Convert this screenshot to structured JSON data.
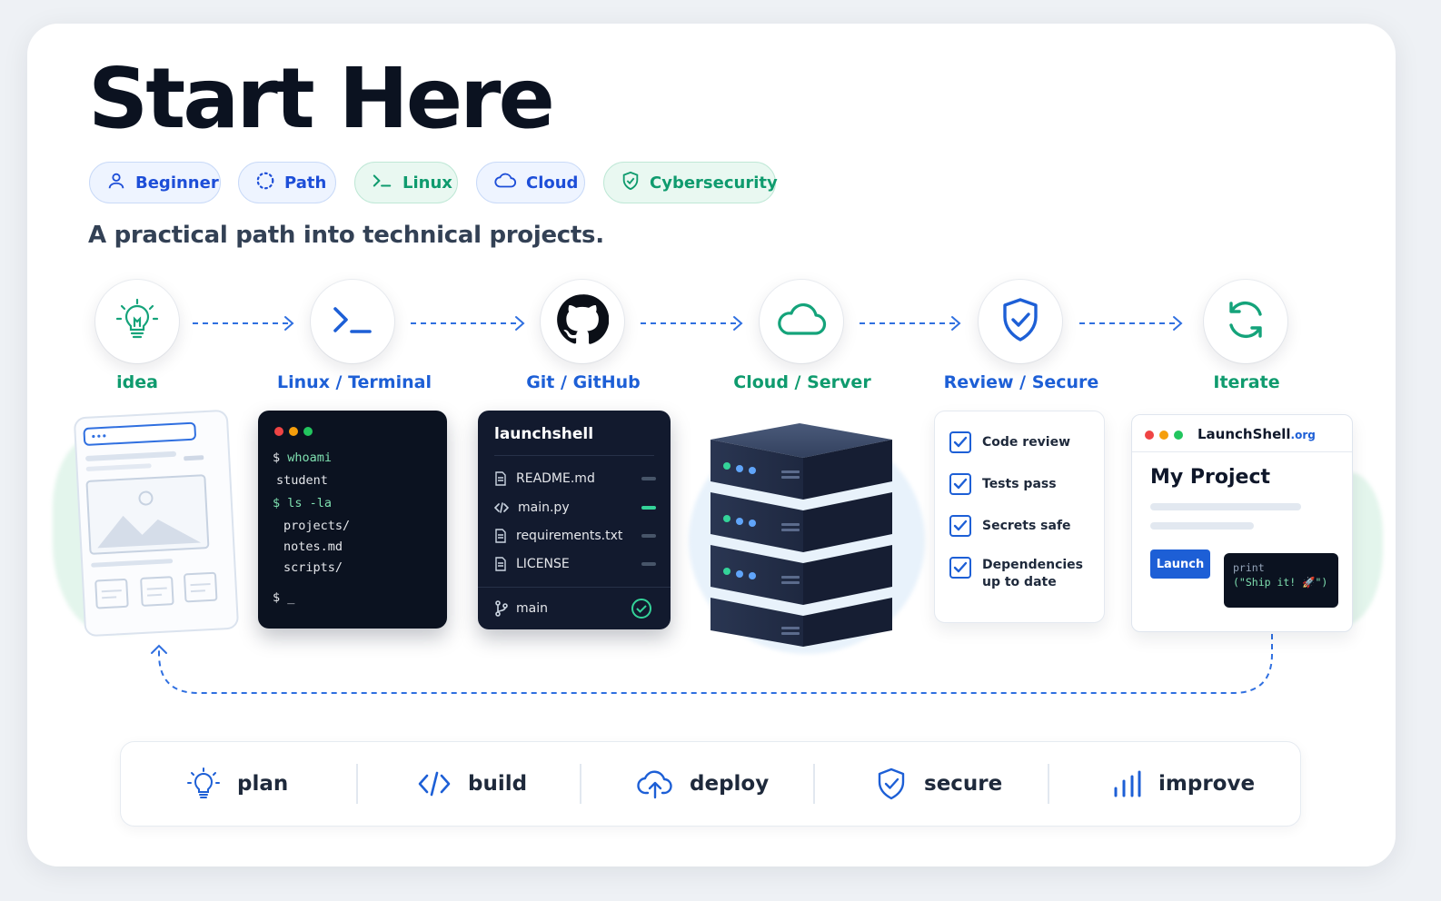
{
  "header": {
    "title": "Start Here",
    "subtitle": "A practical path into technical projects.",
    "tags": [
      {
        "label": "Beginner",
        "icon": "user-icon",
        "tone": "blue"
      },
      {
        "label": "Path",
        "icon": "dotted-circle-icon",
        "tone": "blue"
      },
      {
        "label": "Linux",
        "icon": "terminal-prompt-icon",
        "tone": "green"
      },
      {
        "label": "Cloud",
        "icon": "cloud-icon",
        "tone": "blue"
      },
      {
        "label": "Cybersecurity",
        "icon": "shield-check-icon",
        "tone": "green"
      }
    ]
  },
  "steps": [
    {
      "label": "idea",
      "icon": "lightbulb-icon"
    },
    {
      "label": "Linux / Terminal",
      "icon": "terminal-icon"
    },
    {
      "label": "Git / GitHub",
      "icon": "github-icon"
    },
    {
      "label": "Cloud / Server",
      "icon": "cloud-icon"
    },
    {
      "label": "Review / Secure",
      "icon": "shield-check-icon"
    },
    {
      "label": "Iterate",
      "icon": "refresh-icon"
    }
  ],
  "terminal": {
    "lines": [
      {
        "prompt": "$ ",
        "text": "whoami"
      },
      {
        "prompt": "",
        "text": "student"
      },
      {
        "prompt": "$ ",
        "text": "ls -la"
      },
      {
        "prompt": "",
        "text": "projects/"
      },
      {
        "prompt": "",
        "text": "notes.md"
      },
      {
        "prompt": "",
        "text": "scripts/"
      },
      {
        "prompt": "$ ",
        "text": "_"
      }
    ]
  },
  "repo": {
    "name": "launchshell",
    "files": [
      "README.md",
      "main.py",
      "requirements.txt",
      "LICENSE"
    ],
    "branch": "main"
  },
  "checklist": {
    "items": [
      "Code review",
      "Tests pass",
      "Secrets safe",
      "Dependencies up to date"
    ],
    "checked": [
      true,
      true,
      true,
      true
    ]
  },
  "browser": {
    "site_name": "LaunchShell",
    "site_tld": ".org",
    "page_title": "My Project",
    "button_label": "Launch",
    "code_line1": "print",
    "code_line2": "(\"Ship it! 🚀\")"
  },
  "bottom_bar": [
    {
      "label": "plan",
      "icon": "lightbulb-icon"
    },
    {
      "label": "build",
      "icon": "code-icon"
    },
    {
      "label": "deploy",
      "icon": "cloud-upload-icon"
    },
    {
      "label": "secure",
      "icon": "shield-check-icon"
    },
    {
      "label": "improve",
      "icon": "bar-chart-icon"
    }
  ],
  "colors": {
    "blue": "#1d5fd6",
    "green": "#0f9b6e",
    "navy": "#0b1220"
  }
}
